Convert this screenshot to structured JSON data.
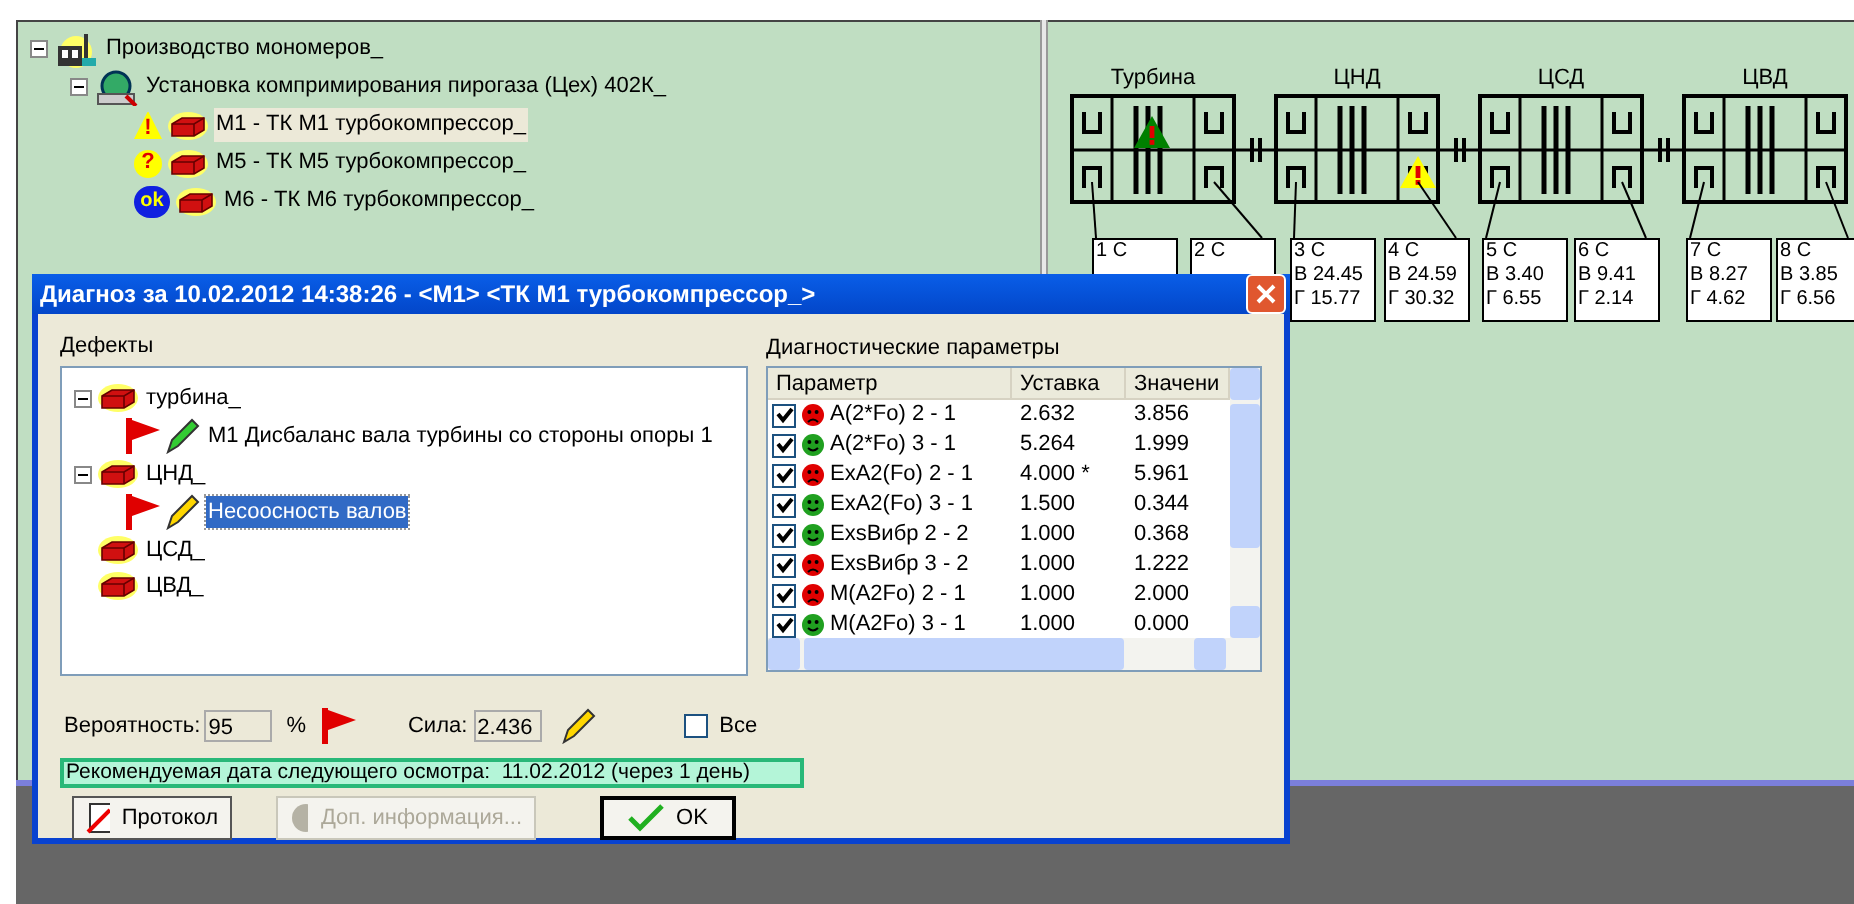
{
  "plant_tree": [
    {
      "label": "Производство мономеров_",
      "expanded": true,
      "children": [
        {
          "label": "Установка компримирования пирогаза (Цех) 402К_",
          "expanded": true,
          "children": [
            {
              "label": "М1 - ТК М1 турбокомпрессор_",
              "kind": "warning",
              "mark": "!",
              "selected": true
            },
            {
              "label": "М5 - ТК М5 турбокомпрессор_",
              "kind": "question",
              "mark": "?",
              "selected": false
            },
            {
              "label": "М6 - ТК М6 турбокомпрессор_",
              "kind": "ok",
              "mark": "ok",
              "selected": false
            }
          ]
        }
      ]
    }
  ],
  "machine_diagram": {
    "units": [
      {
        "label": "Турбина",
        "alarm": {
          "at_bearing": false,
          "color": "#008000"
        }
      },
      {
        "label": "ЦНД",
        "alarm": {
          "at_bearing": true,
          "color": "#ffff00"
        }
      },
      {
        "label": "ЦСД"
      },
      {
        "label": "ЦВД"
      }
    ],
    "sensors": [
      {
        "label": "1 С"
      },
      {
        "label": "2 С"
      },
      {
        "label": "3 С",
        "lines": [
          "В 24.45",
          "Г 15.77"
        ]
      },
      {
        "label": "4 С",
        "lines": [
          "В 24.59",
          "Г 30.32"
        ]
      },
      {
        "label": "5 С",
        "lines": [
          "В 3.40",
          "Г 6.55"
        ]
      },
      {
        "label": "6 С",
        "lines": [
          "В 9.41",
          "Г 2.14"
        ]
      },
      {
        "label": "7 С",
        "lines": [
          "В 8.27",
          "Г 4.62"
        ]
      },
      {
        "label": "8 С",
        "lines": [
          "В 3.85",
          "Г 6.56"
        ]
      }
    ]
  },
  "dialog": {
    "title": "Диагноз за 10.02.2012 14:38:26 - <М1> <ТК М1 турбокомпрессор_>",
    "defects": {
      "label": "Дефекты",
      "tree": [
        {
          "label": "турбина_",
          "expanded": true,
          "children": [
            {
              "label": "М1 Дисбаланс вала турбины со стороны опоры 1",
              "color": "#33cc33",
              "selected": false
            }
          ]
        },
        {
          "label": "ЦНД_",
          "expanded": true,
          "children": [
            {
              "label": "Несоосность валов",
              "color": "#ffd700",
              "selected": true
            }
          ]
        },
        {
          "label": "ЦСД_"
        },
        {
          "label": "ЦВД_"
        }
      ]
    },
    "parameters": {
      "label": "Диагностические параметры",
      "columns": [
        "Параметр",
        "Уставка",
        "Значени"
      ],
      "rows": [
        {
          "checked": true,
          "fault": true,
          "name": "A(2*Fo) 2 - 1",
          "setpoint": "2.632",
          "value": "3.856"
        },
        {
          "checked": true,
          "fault": false,
          "name": "A(2*Fo) 3 - 1",
          "setpoint": "5.264",
          "value": "1.999"
        },
        {
          "checked": true,
          "fault": true,
          "name": "ExA2(Fo) 2 - 1",
          "setpoint": "4.000 *",
          "value": "5.961"
        },
        {
          "checked": true,
          "fault": false,
          "name": "ExA2(Fo) 3 - 1",
          "setpoint": "1.500",
          "value": "0.344"
        },
        {
          "checked": true,
          "fault": false,
          "name": "ExsВибр 2 - 2",
          "setpoint": "1.000",
          "value": "0.368"
        },
        {
          "checked": true,
          "fault": true,
          "name": "ExsВибр 3 - 2",
          "setpoint": "1.000",
          "value": "1.222"
        },
        {
          "checked": true,
          "fault": true,
          "name": "M(A2Fo) 2 - 1",
          "setpoint": "1.000",
          "value": "2.000"
        },
        {
          "checked": true,
          "fault": false,
          "name": "M(A2Fo) 3 - 1",
          "setpoint": "1.000",
          "value": "0.000"
        }
      ]
    },
    "probability": {
      "label": "Вероятность:",
      "value": "95",
      "unit": "%"
    },
    "force": {
      "label": "Сила:",
      "value": "2.436"
    },
    "show_all": {
      "label": "Все",
      "checked": false
    },
    "status": "Рекомендуемая дата следующего осмотра:  11.02.2012 (через 1 день)",
    "buttons": [
      {
        "label": "Протокол",
        "kind": "protocol",
        "disabled": false
      },
      {
        "label": "Доп. информация...",
        "kind": "info",
        "disabled": true
      },
      {
        "label": "OK",
        "kind": "ok",
        "disabled": false
      }
    ]
  }
}
